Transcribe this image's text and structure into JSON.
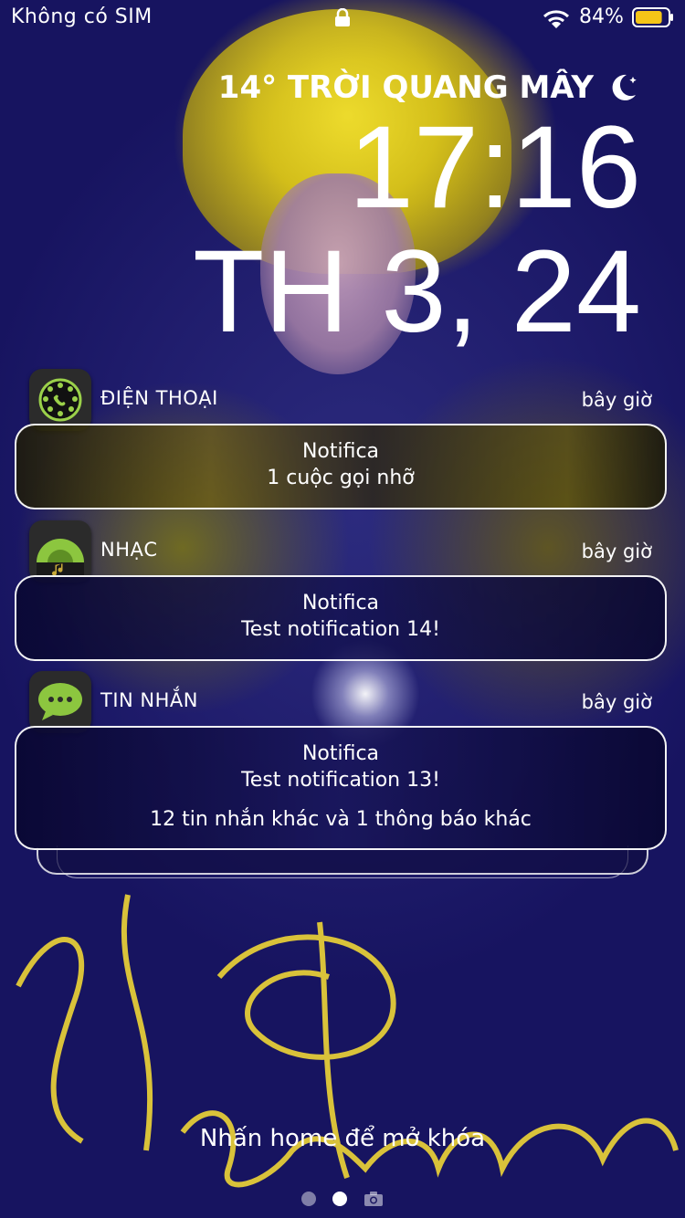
{
  "status_bar": {
    "carrier": "Không có SIM",
    "battery_percent": "84%",
    "battery_level": 0.84,
    "battery_color": "#f5c518",
    "icons": [
      "lock-icon",
      "wifi-icon",
      "battery-icon"
    ]
  },
  "lockscreen": {
    "weather": "14° TRỜI QUANG MÂY",
    "weather_icon": "moon-icon",
    "time": "17:16",
    "date": "TH 3, 24"
  },
  "notifications": [
    {
      "app": "ĐIỆN THOẠI",
      "icon": "phone-app-icon",
      "time": "bây giờ",
      "title": "Notifica",
      "body": "1 cuộc gọi nhỡ"
    },
    {
      "app": "NHẠC",
      "icon": "music-app-icon",
      "time": "bây giờ",
      "title": "Notifica",
      "body": "Test notification 14!"
    },
    {
      "app": "TIN NHẮN",
      "icon": "messages-app-icon",
      "time": "bây giờ",
      "title": "Notifica",
      "body": "Test notification 13!",
      "extra": "12 tin nhắn khác và 1 thông báo khác"
    }
  ],
  "footer": {
    "unlock_hint": "Nhấn home để mở khóa",
    "page_indicator": [
      "dot",
      "dot-active",
      "camera-icon"
    ]
  }
}
